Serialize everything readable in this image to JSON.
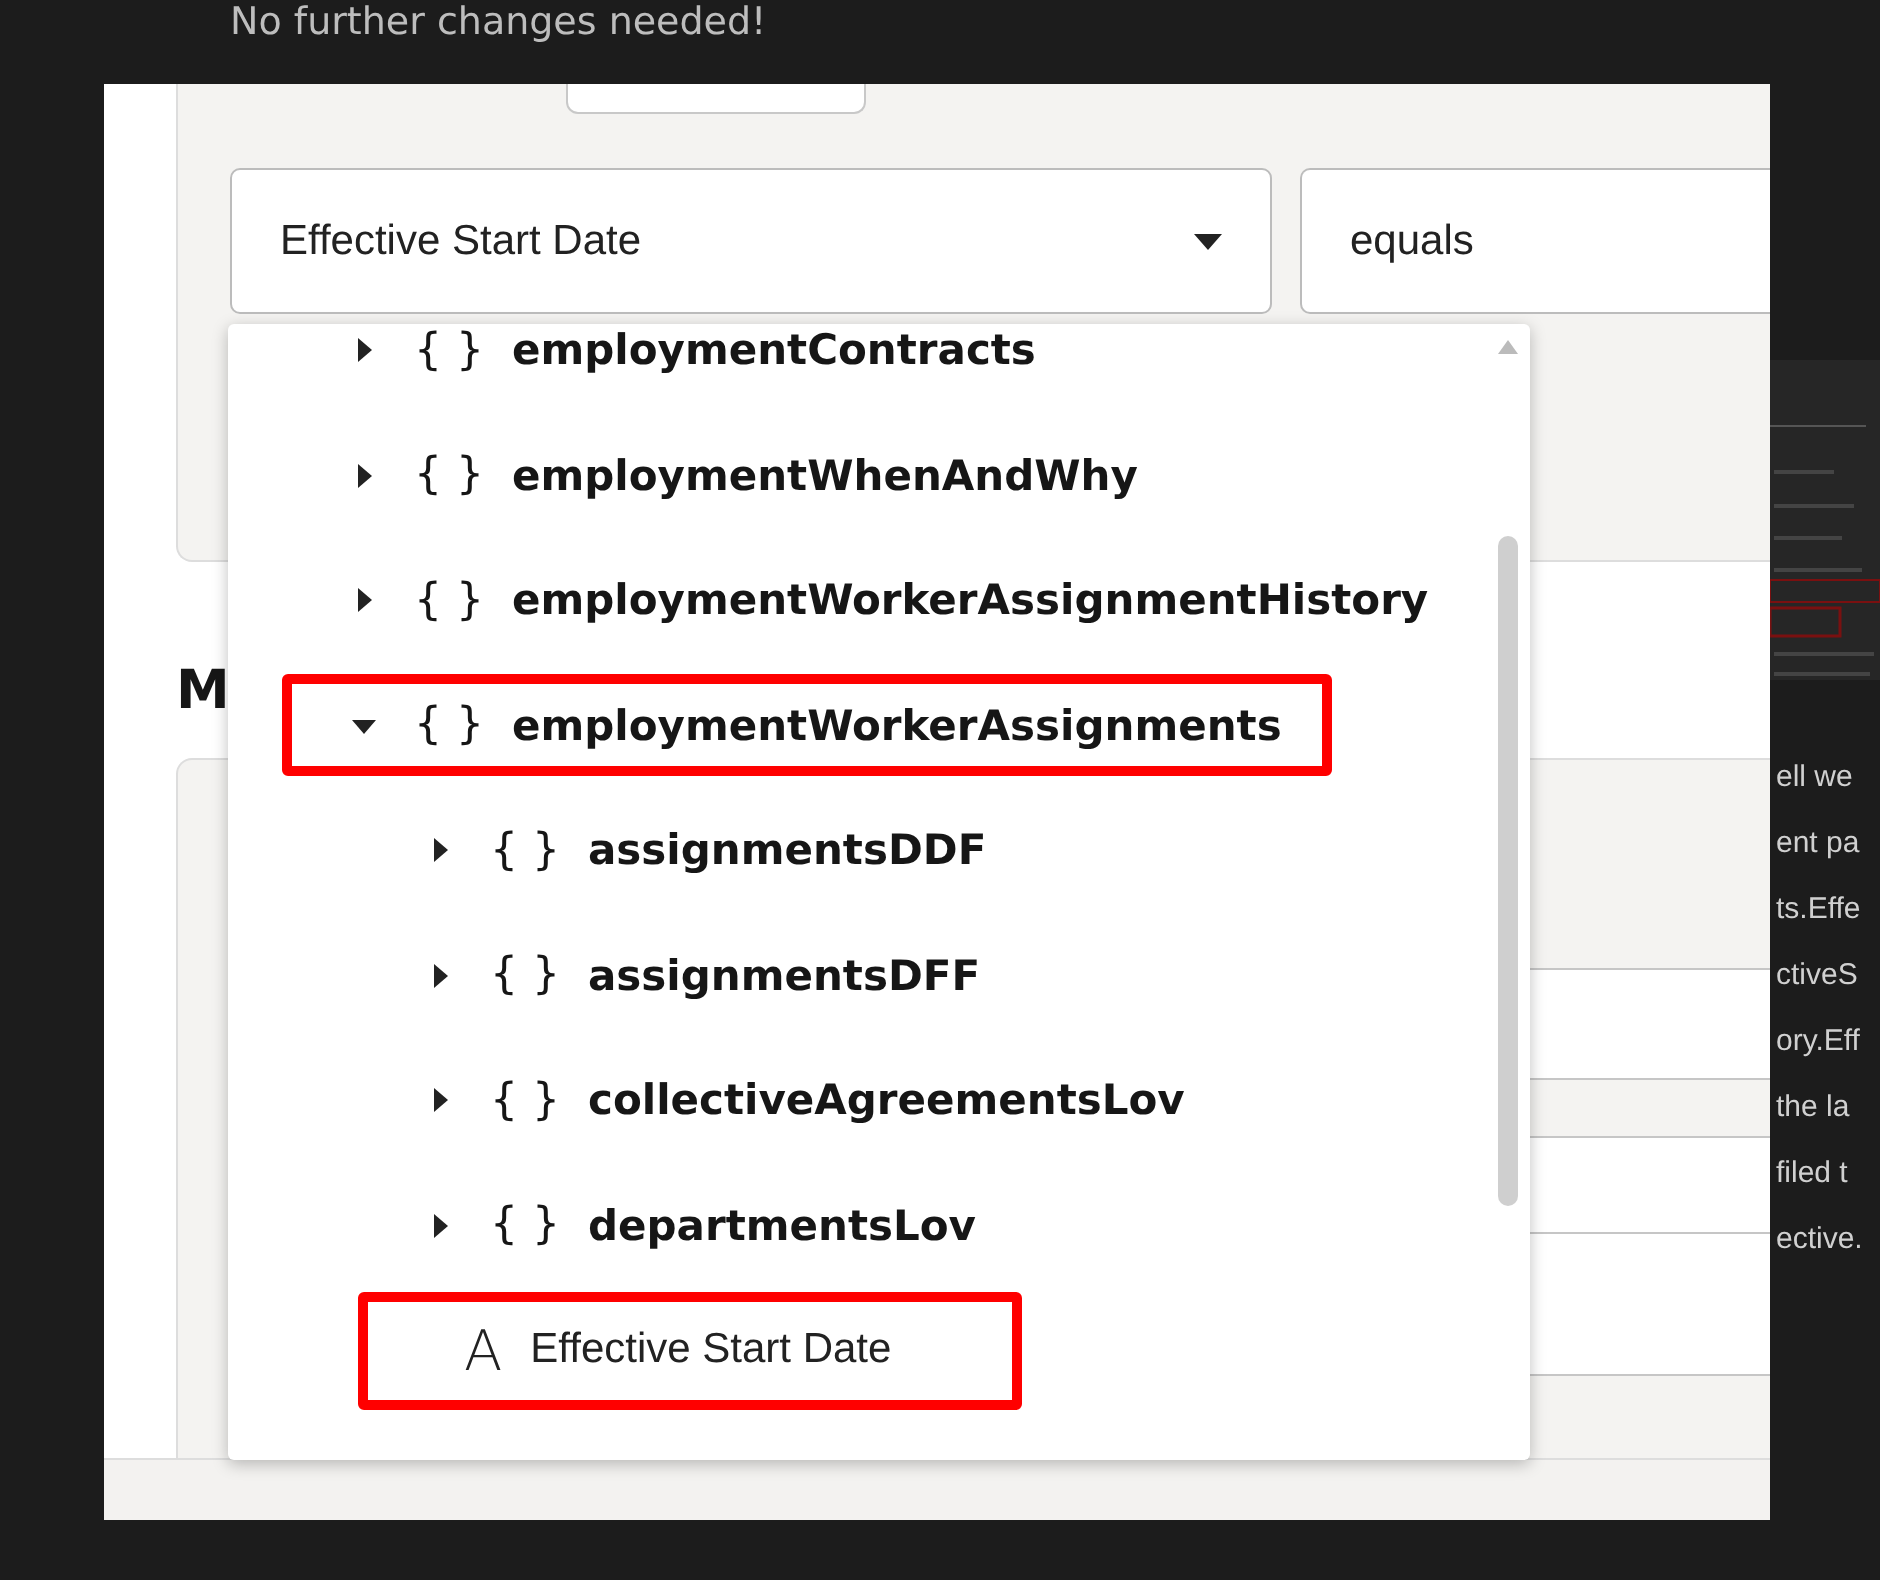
{
  "caption": "No further changes needed!",
  "filter": {
    "attribute": "Effective Start Date",
    "operator": "equals"
  },
  "section_heading": "M",
  "tree": [
    {
      "kind": "object",
      "icon": "{ }",
      "label": "employmentContracts",
      "expanded": false,
      "highlighted": false
    },
    {
      "kind": "object",
      "icon": "{ }",
      "label": "employmentWhenAndWhy",
      "expanded": false,
      "highlighted": false
    },
    {
      "kind": "object",
      "icon": "{ }",
      "label": "employmentWorkerAssignmentHistory",
      "expanded": false,
      "highlighted": false
    },
    {
      "kind": "object",
      "icon": "{ }",
      "label": "employmentWorkerAssignments",
      "expanded": true,
      "highlighted": true,
      "children": [
        {
          "kind": "object",
          "icon": "{ }",
          "label": "assignmentsDDF",
          "expanded": false,
          "highlighted": false
        },
        {
          "kind": "object",
          "icon": "{ }",
          "label": "assignmentsDFF",
          "expanded": false,
          "highlighted": false
        },
        {
          "kind": "object",
          "icon": "{ }",
          "label": "collectiveAgreementsLov",
          "expanded": false,
          "highlighted": false
        },
        {
          "kind": "object",
          "icon": "{ }",
          "label": "departmentsLov",
          "expanded": false,
          "highlighted": false
        },
        {
          "kind": "attribute",
          "icon": "A",
          "label": "Effective Start Date",
          "highlighted": true
        }
      ]
    }
  ],
  "side_text": [
    "ell we",
    "ent pa",
    "ts.Effe",
    "ctiveS",
    "ory.Eff",
    "the la",
    "filed t",
    "ective."
  ]
}
